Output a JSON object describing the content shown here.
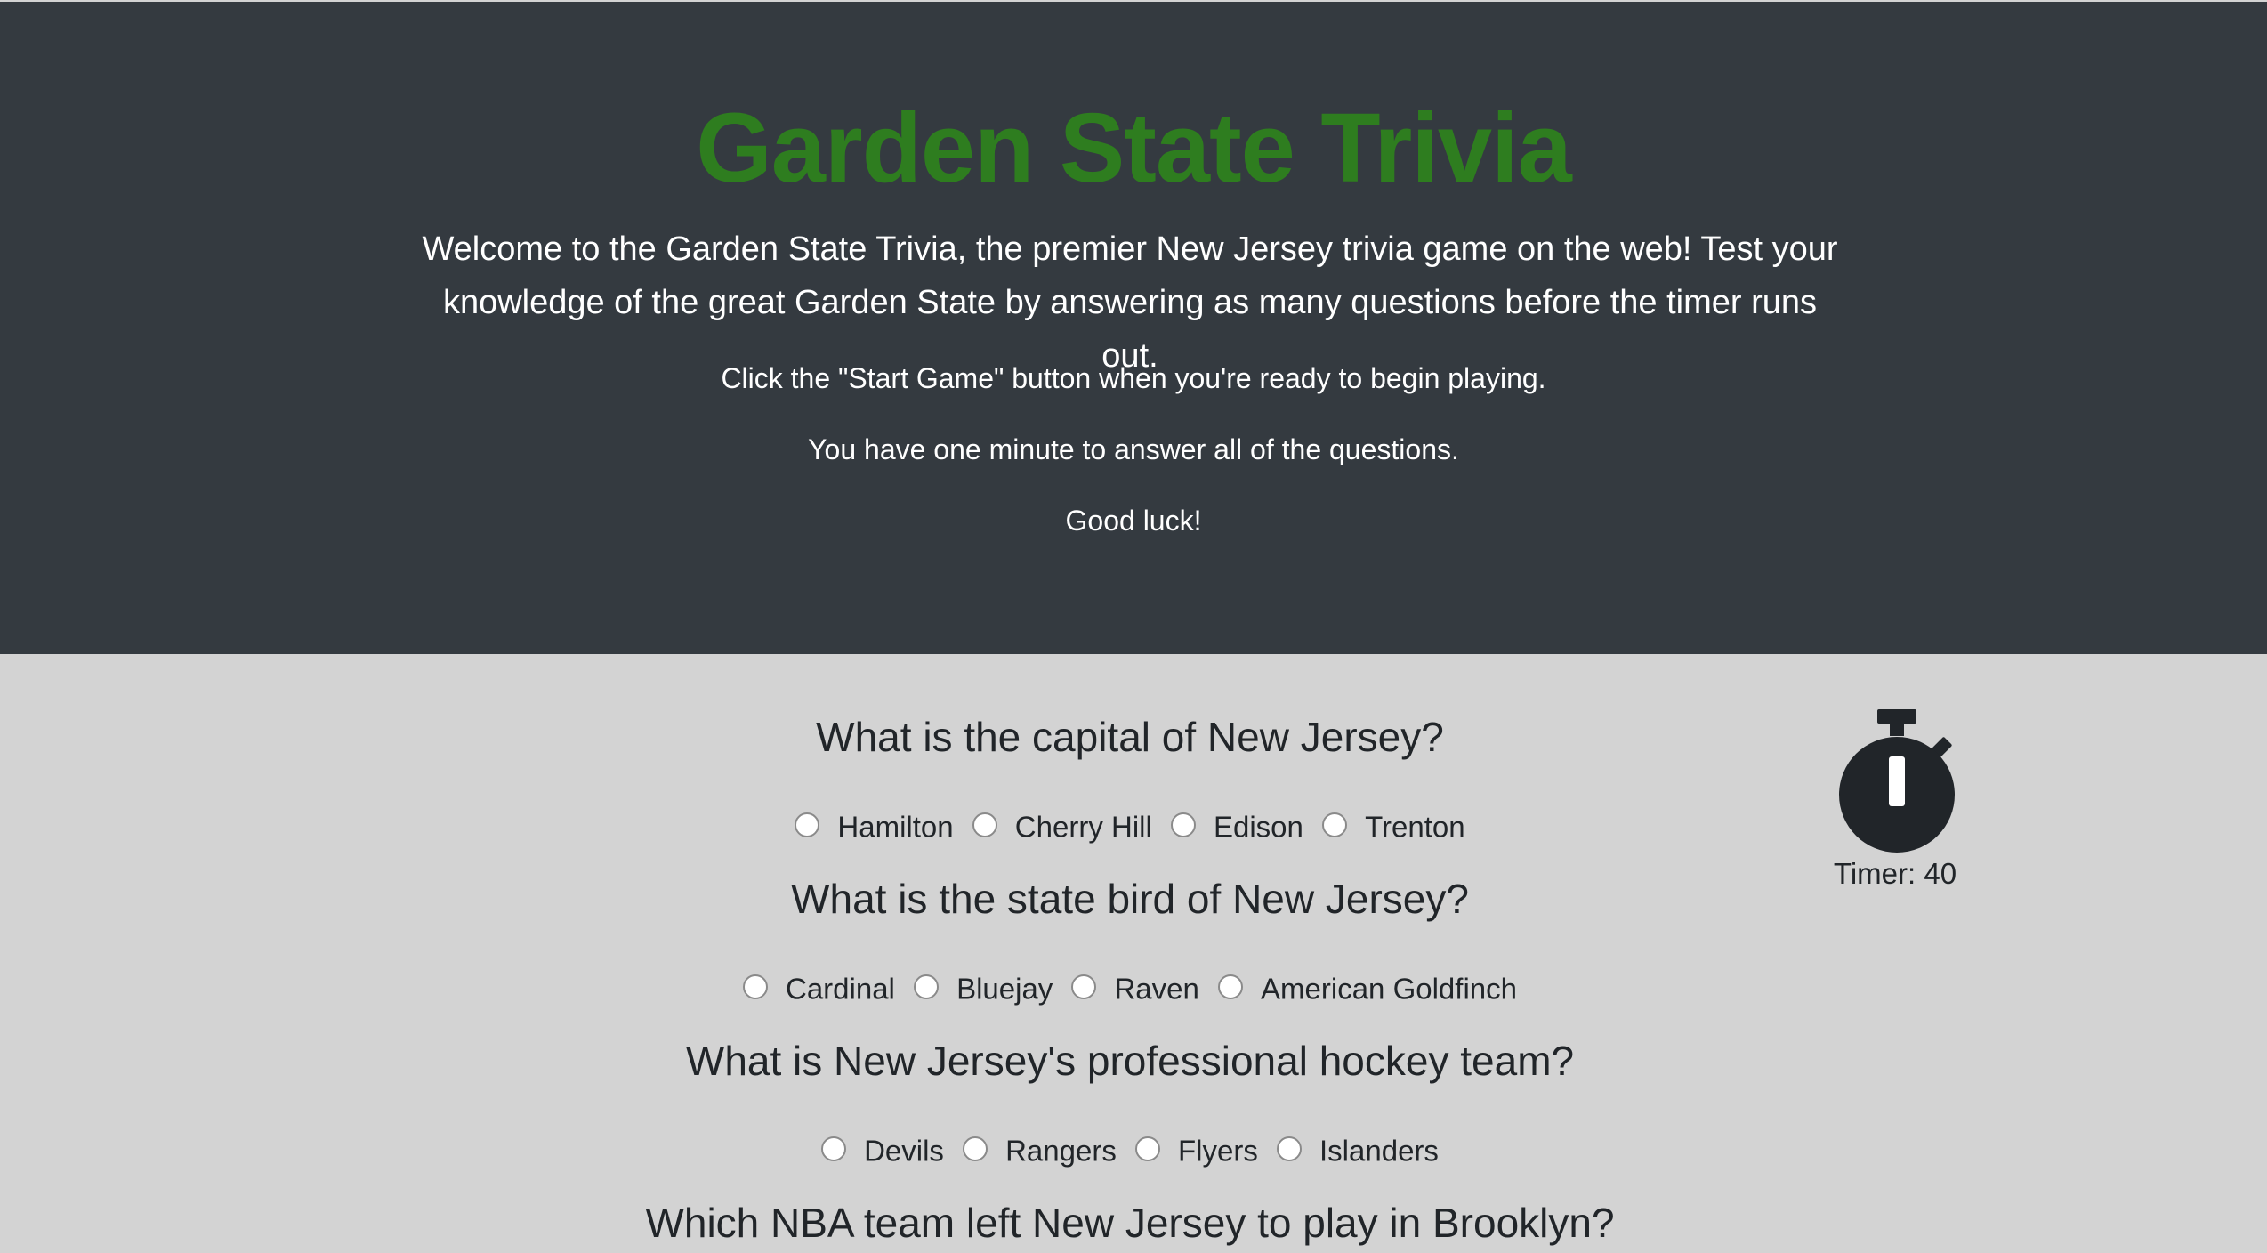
{
  "hero": {
    "title": "Garden State Trivia",
    "lead": "Welcome to the Garden State Trivia, the premier New Jersey trivia game on the web! Test your knowledge of the great Garden State by answering as many questions before the timer runs out.",
    "instructions": [
      "Click the \"Start Game\" button when you're ready to begin playing.",
      "You have one minute to answer all of the questions.",
      "Good luck!"
    ]
  },
  "colors": {
    "hero_bg": "#343a40",
    "title": "#2e7d1f",
    "page_bg": "#d3d3d3",
    "text": "#212529"
  },
  "timer": {
    "icon": "stopwatch-icon",
    "label": "Timer: 40"
  },
  "questions": [
    {
      "text": "What is the capital of New Jersey?",
      "options": [
        "Hamilton",
        "Cherry Hill",
        "Edison",
        "Trenton"
      ]
    },
    {
      "text": "What is the state bird of New Jersey?",
      "options": [
        "Cardinal",
        "Bluejay",
        "Raven",
        "American Goldfinch"
      ]
    },
    {
      "text": "What is New Jersey's professional hockey team?",
      "options": [
        "Devils",
        "Rangers",
        "Flyers",
        "Islanders"
      ]
    },
    {
      "text": "Which NBA team left New Jersey to play in Brooklyn?",
      "options": []
    }
  ]
}
